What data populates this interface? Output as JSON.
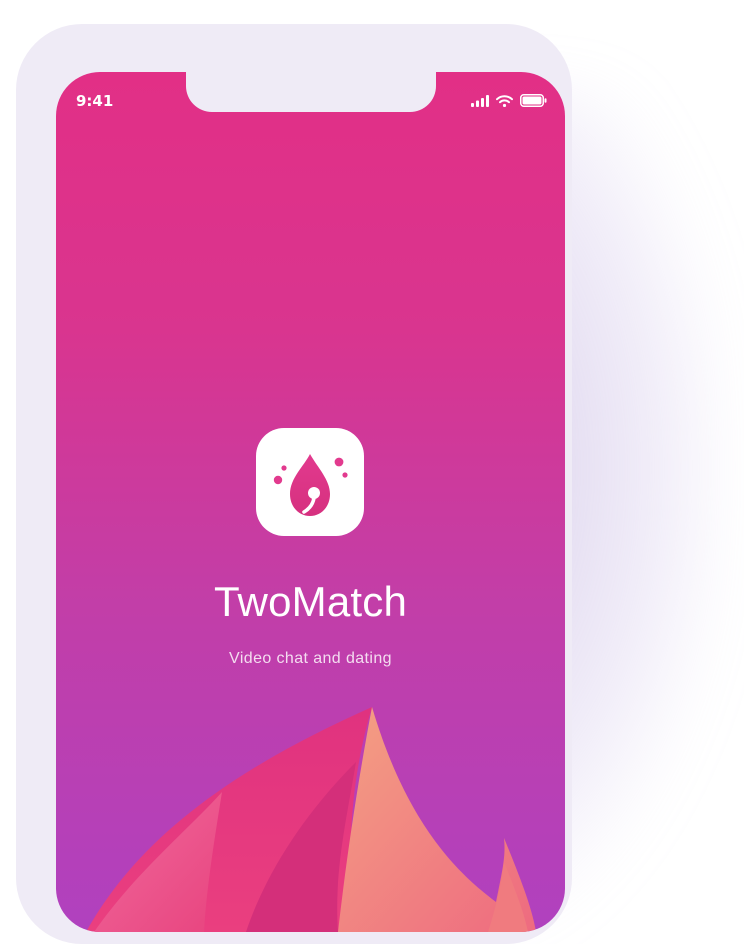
{
  "status_bar": {
    "time": "9:41",
    "icons": [
      "signal-icon",
      "wifi-icon",
      "battery-icon"
    ]
  },
  "app": {
    "icon": "flame-logo-icon",
    "name": "TwoMatch",
    "tagline": "Video chat and dating"
  },
  "colors": {
    "gradient_top": "#e22f86",
    "gradient_bottom": "#b041bf",
    "frame": "#efebf6",
    "text": "#ffffff"
  }
}
